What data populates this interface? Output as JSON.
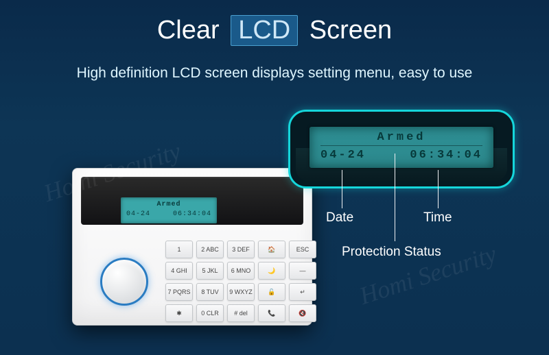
{
  "header": {
    "title_prefix": "Clear",
    "title_highlight": "LCD",
    "title_suffix": "Screen",
    "subtitle": "High definition LCD screen displays setting menu, easy to use"
  },
  "lcd": {
    "status": "Armed",
    "date": "04-24",
    "time": "06:34:04"
  },
  "callout_labels": {
    "date": "Date",
    "time": "Time",
    "status": "Protection Status"
  },
  "keypad": {
    "rows": [
      [
        "1",
        "2 ABC",
        "3 DEF",
        "🏠",
        "ESC"
      ],
      [
        "4 GHI",
        "5 JKL",
        "6 MNO",
        "🌙",
        "—"
      ],
      [
        "7 PQRS",
        "8 TUV",
        "9 WXYZ",
        "🔓",
        "↵"
      ],
      [
        "✱",
        "0 CLR",
        "# del",
        "📞",
        "🔇"
      ]
    ]
  },
  "watermark": "Homi Security"
}
